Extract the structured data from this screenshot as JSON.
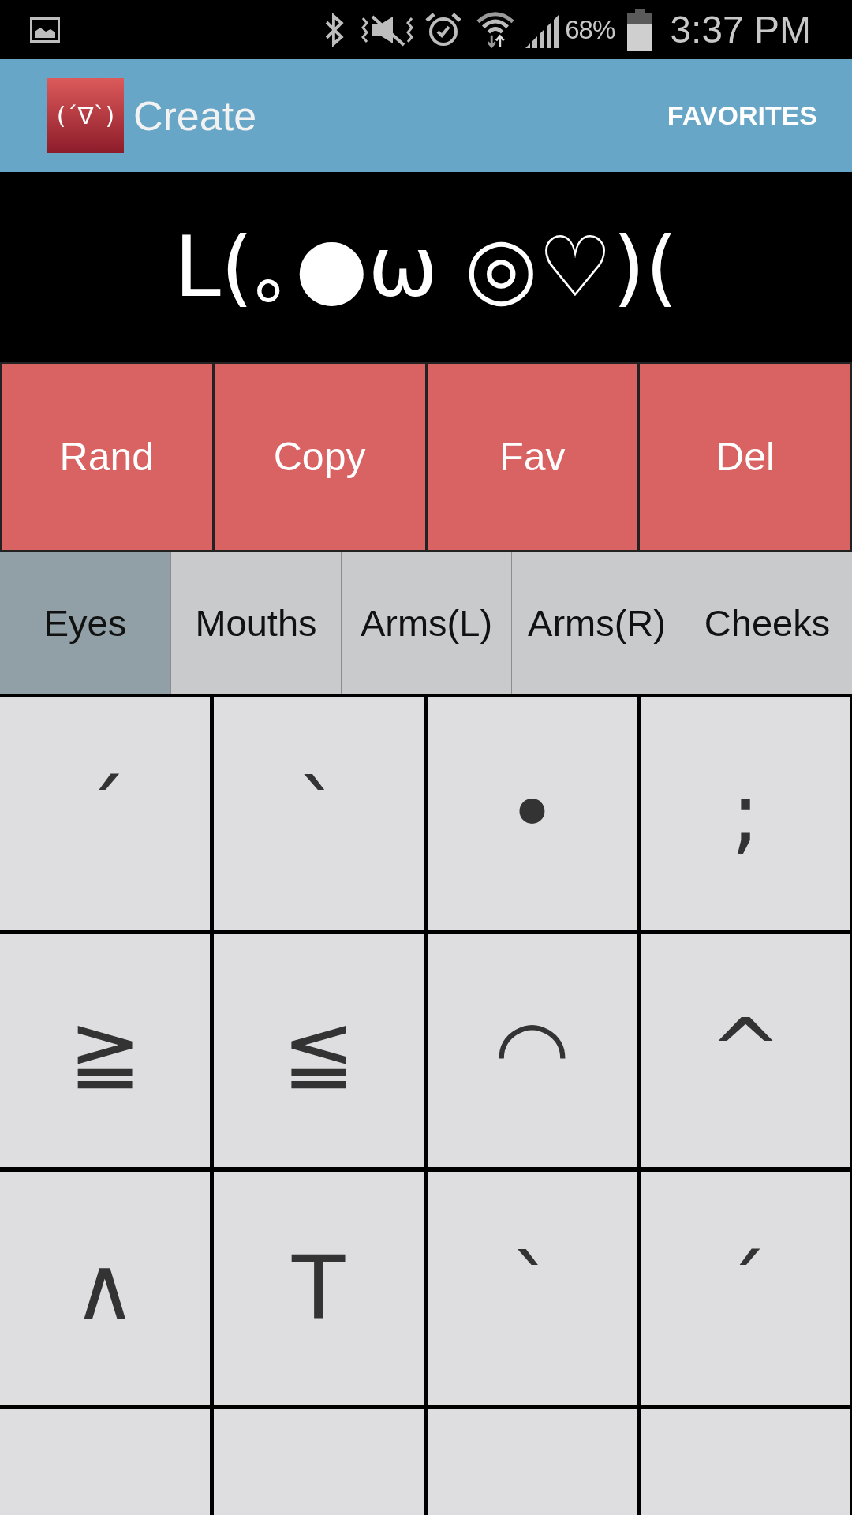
{
  "status_bar": {
    "battery_percent": "68%",
    "time": "3:37 PM"
  },
  "app_bar": {
    "logo_text": "(´∇`)",
    "title": "Create",
    "action": "FAVORITES"
  },
  "preview": {
    "text": "ᒪ(｡●ω ◎♡)("
  },
  "buttons": [
    "Rand",
    "Copy",
    "Fav",
    "Del"
  ],
  "tabs": [
    {
      "label": "Eyes",
      "selected": true
    },
    {
      "label": "Mouths",
      "selected": false
    },
    {
      "label": "Arms(L)",
      "selected": false
    },
    {
      "label": "Arms(R)",
      "selected": false
    },
    {
      "label": "Cheeks",
      "selected": false
    }
  ],
  "keys": [
    {
      "kind": "symbol",
      "symbol": "´"
    },
    {
      "kind": "symbol",
      "symbol": "`"
    },
    {
      "kind": "symbol",
      "symbol": "•"
    },
    {
      "kind": "symbol",
      "symbol": ";"
    },
    {
      "kind": "symbol",
      "symbol": "≧"
    },
    {
      "kind": "symbol",
      "symbol": "≦"
    },
    {
      "kind": "symbol",
      "symbol": "◠"
    },
    {
      "kind": "symbol",
      "symbol": "^"
    },
    {
      "kind": "symbol",
      "symbol": "∧"
    },
    {
      "kind": "symbol",
      "symbol": "T"
    },
    {
      "kind": "symbol",
      "symbol": "`"
    },
    {
      "kind": "symbol",
      "symbol": "´"
    },
    {
      "kind": "clipped"
    },
    {
      "kind": "clipped"
    },
    {
      "kind": "clipped"
    },
    {
      "kind": "clipped"
    }
  ]
}
